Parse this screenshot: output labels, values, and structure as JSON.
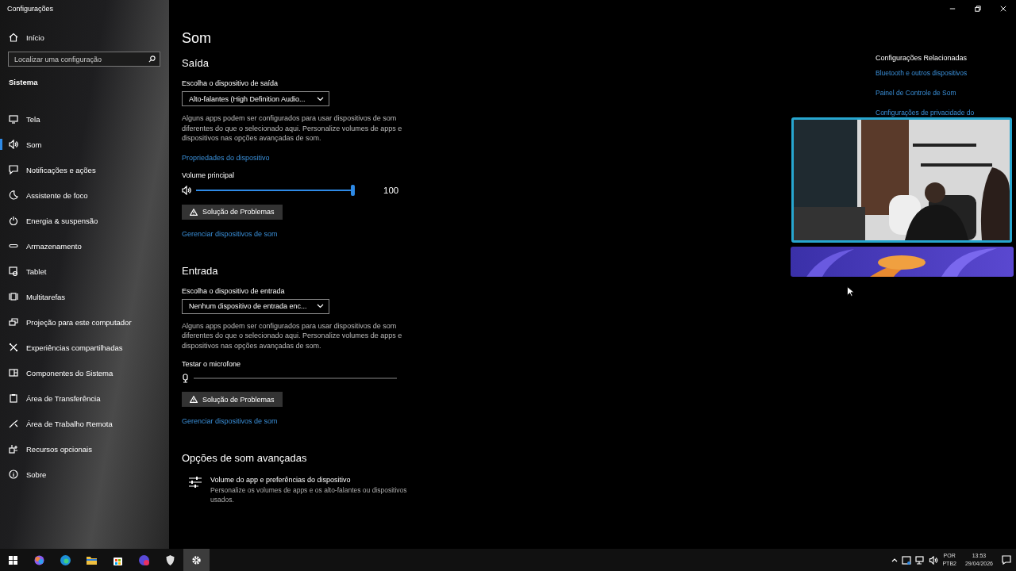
{
  "window": {
    "title": "Configurações"
  },
  "sidebar": {
    "home": "Início",
    "search": {
      "placeholder": "Localizar uma configuração"
    },
    "section": "Sistema",
    "items": [
      {
        "label": "Tela",
        "selected": false
      },
      {
        "label": "Som",
        "selected": true
      },
      {
        "label": "Notificações e ações",
        "selected": false
      },
      {
        "label": "Assistente de foco",
        "selected": false
      },
      {
        "label": "Energia & suspensão",
        "selected": false
      },
      {
        "label": "Armazenamento",
        "selected": false
      },
      {
        "label": "Tablet",
        "selected": false
      },
      {
        "label": "Multitarefas",
        "selected": false
      },
      {
        "label": "Projeção para este computador",
        "selected": false
      },
      {
        "label": "Experiências compartilhadas",
        "selected": false
      },
      {
        "label": "Componentes do Sistema",
        "selected": false
      },
      {
        "label": "Área de Transferência",
        "selected": false
      },
      {
        "label": "Área de Trabalho Remota",
        "selected": false
      },
      {
        "label": "Recursos opcionais",
        "selected": false
      },
      {
        "label": "Sobre",
        "selected": false
      }
    ]
  },
  "page": {
    "title": "Som",
    "output": {
      "heading": "Saída",
      "device_label": "Escolha o dispositivo de saída",
      "device": "Alto-falantes (High Definition Audio...",
      "description": "Alguns apps podem ser configurados para usar dispositivos de som diferentes do que o selecionado aqui. Personalize volumes de apps e dispositivos nas opções avançadas de som.",
      "properties_link": "Propriedades do dispositivo",
      "volume_label": "Volume principal",
      "volume": {
        "level": 1,
        "reading": "100"
      },
      "troubleshoot": "Solução de Problemas",
      "manage_link": "Gerenciar dispositivos de som"
    },
    "input": {
      "heading": "Entrada",
      "device_label": "Escolha o dispositivo de entrada",
      "device": "Nenhum dispositivo de entrada enc...",
      "description": "Alguns apps podem ser configurados para usar dispositivos de som diferentes do que o selecionado aqui. Personalize volumes de apps e dispositivos nas opções avançadas de som.",
      "mic_label": "Testar o microfone",
      "mic": {
        "level": 0
      },
      "troubleshoot": "Solução de Problemas",
      "manage_link": "Gerenciar dispositivos de som"
    },
    "advanced": {
      "heading": "Opções de som avançadas",
      "item_title": "Volume do app e preferências do dispositivo",
      "item_description": "Personalize os volumes de apps e os alto-falantes ou dispositivos usados."
    }
  },
  "related": {
    "heading": "Configurações Relacionadas",
    "links": [
      "Bluetooth e outros dispositivos",
      "Painel de Controle de Som",
      "Configurações de privacidade do"
    ]
  },
  "taskbar": {
    "apps": [
      {
        "selected": false
      },
      {
        "selected": false
      },
      {
        "selected": false
      },
      {
        "selected": false
      },
      {
        "selected": false
      },
      {
        "selected": false
      },
      {
        "selected": false
      },
      {
        "selected": true
      }
    ],
    "tray": {
      "language": "POR",
      "layout": "PTB2",
      "time": "13:53",
      "date": "29/04/2026"
    }
  }
}
